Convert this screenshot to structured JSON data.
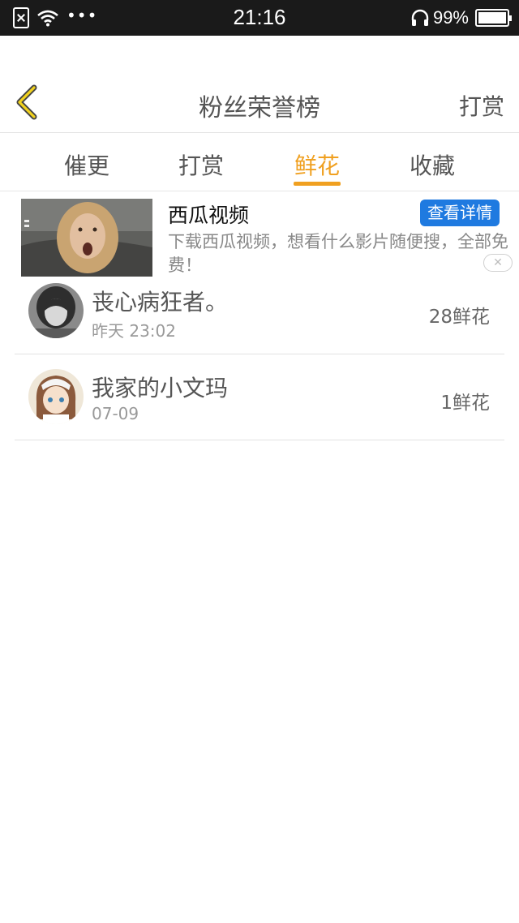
{
  "status_bar": {
    "time": "21:16",
    "battery": "99%",
    "battery_level": 0.99,
    "icons": [
      "sim-error-icon",
      "wifi-icon",
      "more-dots-icon",
      "headphone-icon",
      "battery-icon"
    ],
    "dots": "•••"
  },
  "header": {
    "back_icon": "chevron-left-icon",
    "title": "粉丝荣誉榜",
    "action": "打赏",
    "accent": "#f0a020"
  },
  "tabs": [
    {
      "label": "催更",
      "active": false
    },
    {
      "label": "打赏",
      "active": false
    },
    {
      "label": "鲜花",
      "active": true
    },
    {
      "label": "收藏",
      "active": false
    }
  ],
  "ad": {
    "title": "西瓜视频",
    "button": "查看详情",
    "button_color": "#1f7ae0",
    "description": "下载西瓜视频，想看什么影片随便搜，全部免费！",
    "close": "✕"
  },
  "fans": [
    {
      "name": "丧心病狂者。",
      "time": "昨天 23:02",
      "count": "28鲜花"
    },
    {
      "name": "我家的小文玛",
      "time": "07-09",
      "count": "1鲜花"
    }
  ]
}
